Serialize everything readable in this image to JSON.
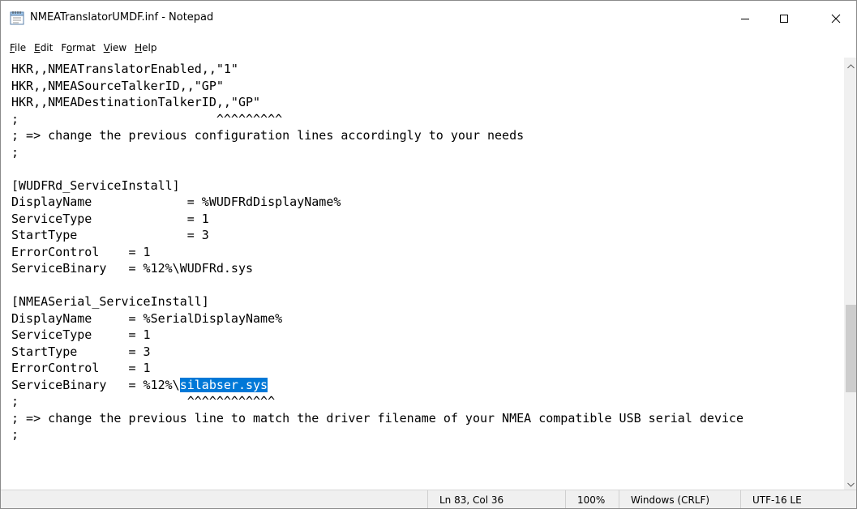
{
  "window": {
    "title": "NMEATranslatorUMDF.inf - Notepad"
  },
  "menu": {
    "file": {
      "accel": "F",
      "rest": "ile"
    },
    "edit": {
      "accel": "E",
      "rest": "dit"
    },
    "format": {
      "pre": "F",
      "accel": "o",
      "rest": "rmat"
    },
    "view": {
      "accel": "V",
      "rest": "iew"
    },
    "help": {
      "accel": "H",
      "rest": "elp"
    }
  },
  "editor": {
    "text_before_selection": "HKR,,NMEATranslatorEnabled,,\"1\"\nHKR,,NMEASourceTalkerID,,\"GP\"\nHKR,,NMEADestinationTalkerID,,\"GP\"\n;                           ^^^^^^^^^\n; => change the previous configuration lines accordingly to your needs\n;\n\n[WUDFRd_ServiceInstall]\nDisplayName             = %WUDFRdDisplayName%\nServiceType             = 1\nStartType               = 3\nErrorControl    = 1\nServiceBinary   = %12%\\WUDFRd.sys\n\n[NMEASerial_ServiceInstall]\nDisplayName     = %SerialDisplayName%\nServiceType     = 1\nStartType       = 3\nErrorControl    = 1\nServiceBinary   = %12%\\",
    "selected_text": "silabser.sys",
    "text_after_selection": "\n;                       ^^^^^^^^^^^^\n; => change the previous line to match the driver filename of your NMEA compatible USB serial device\n;"
  },
  "statusbar": {
    "position": "Ln 83, Col 36",
    "zoom": "100%",
    "line_ending": "Windows (CRLF)",
    "encoding": "UTF-16 LE"
  },
  "colors": {
    "selection": "#0078d7",
    "statusbar_bg": "#f0f0f0",
    "scroll_thumb": "#cdcdcd"
  },
  "icons": {
    "app": "notepad-icon",
    "minimize": "minimize-icon",
    "maximize": "maximize-icon",
    "close": "close-icon",
    "scroll_up": "chevron-up-icon",
    "scroll_down": "chevron-down-icon"
  }
}
